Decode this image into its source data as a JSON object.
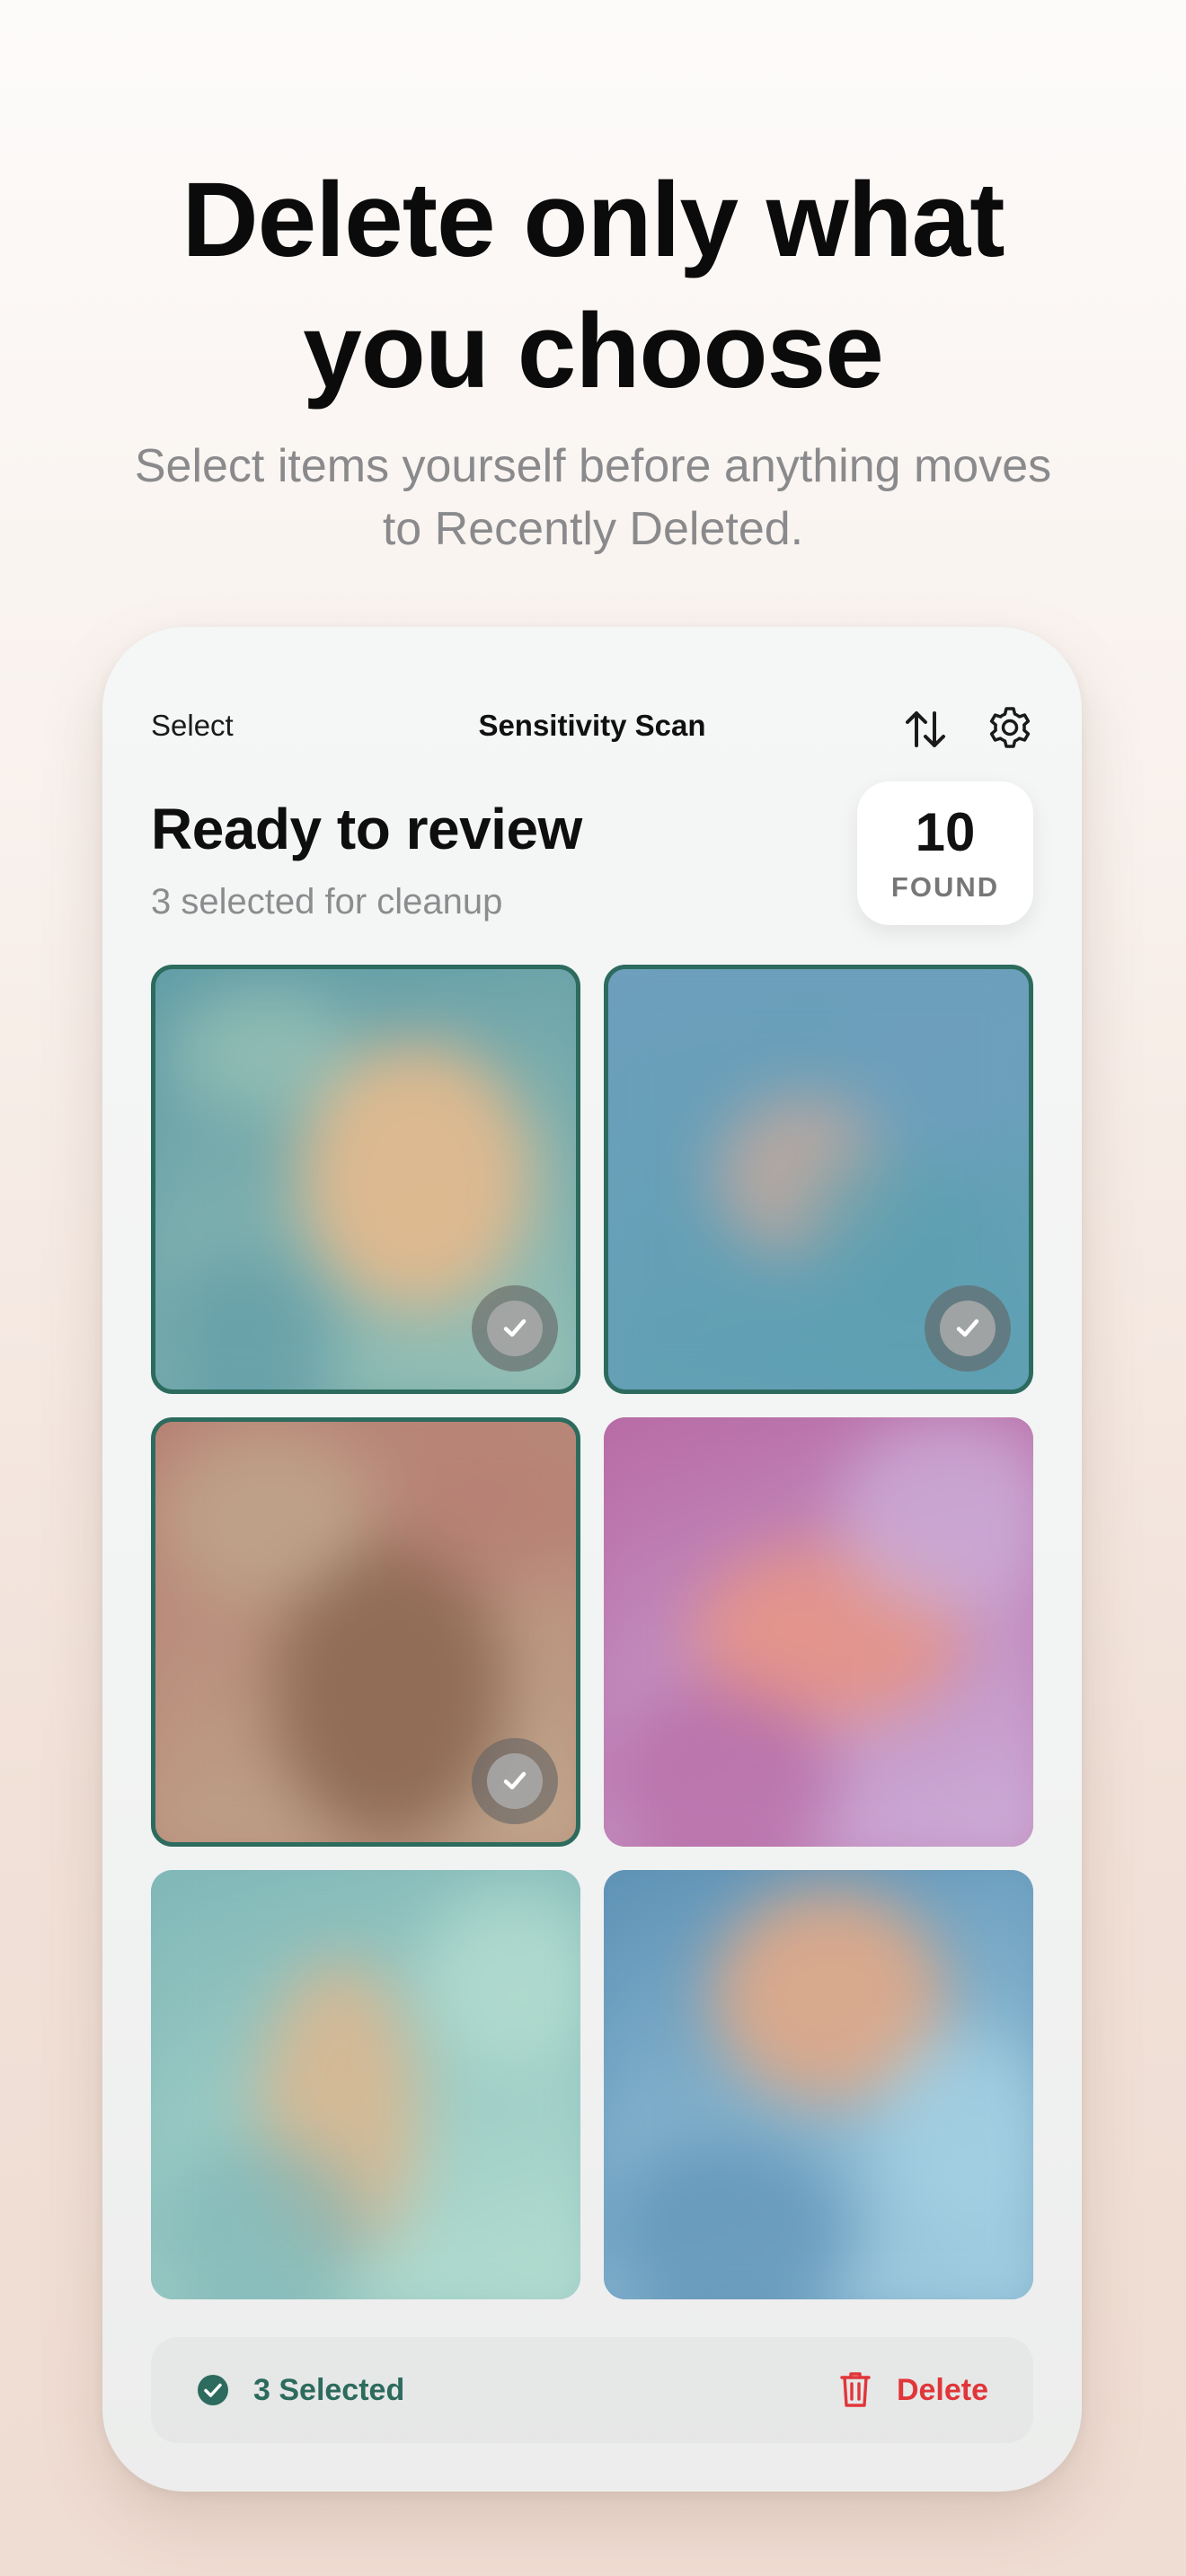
{
  "headline": {
    "line1": "Delete only what",
    "line2": "you choose"
  },
  "subhead": {
    "line1": "Select items yourself before anything moves",
    "line2": "to Recently Deleted."
  },
  "nav": {
    "select_label": "Select",
    "title": "Sensitivity Scan",
    "sort_icon": "sort-arrows-icon",
    "settings_icon": "gear-icon"
  },
  "review": {
    "title": "Ready to review",
    "subtitle": "3 selected for cleanup",
    "found_count": "10",
    "found_label": "FOUND"
  },
  "grid": {
    "items": [
      {
        "selected": true,
        "palette": [
          "#5e9aa6",
          "#e2b98e",
          "#9cc4b6"
        ]
      },
      {
        "selected": true,
        "palette": [
          "#6f9fbd",
          "#b8a8a0",
          "#5ba0b0"
        ]
      },
      {
        "selected": true,
        "palette": [
          "#b67d72",
          "#8e6a55",
          "#c0aa8e"
        ]
      },
      {
        "selected": false,
        "palette": [
          "#b768a2",
          "#e4958a",
          "#cdb2dc"
        ]
      },
      {
        "selected": false,
        "palette": [
          "#7db5b6",
          "#d6b893",
          "#b8e0d2"
        ]
      },
      {
        "selected": false,
        "palette": [
          "#5b8fb3",
          "#dca98a",
          "#a9d4e6"
        ]
      }
    ]
  },
  "bottom_bar": {
    "selected_label": "3 Selected",
    "delete_label": "Delete",
    "selected_icon": "checkmark-circle-icon",
    "delete_icon": "trash-icon"
  },
  "colors": {
    "accent": "#2c6b5d",
    "destructive": "#e0363a"
  }
}
